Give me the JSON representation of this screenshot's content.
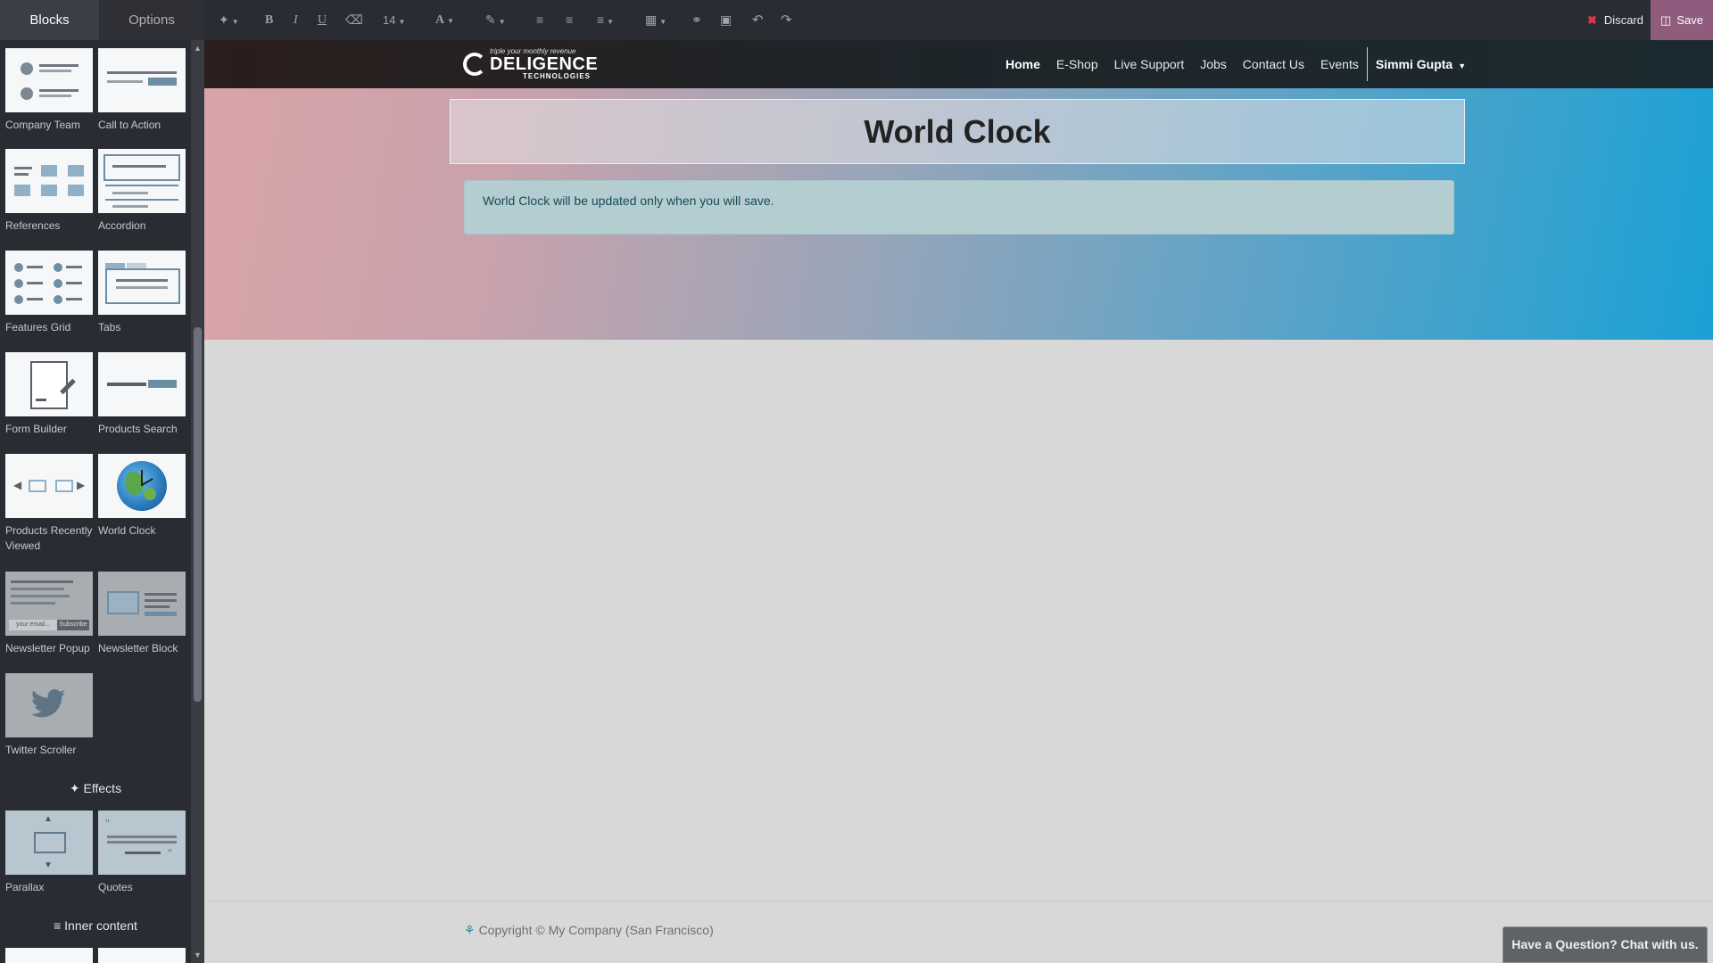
{
  "sidebar": {
    "tabs": [
      "Blocks",
      "Options"
    ],
    "blocks": [
      {
        "label": "Company Team"
      },
      {
        "label": "Call to Action"
      },
      {
        "label": "References"
      },
      {
        "label": "Accordion"
      },
      {
        "label": "Features Grid"
      },
      {
        "label": "Tabs"
      },
      {
        "label": "Form Builder"
      },
      {
        "label": "Products Search"
      },
      {
        "label": "Products Recently Viewed"
      },
      {
        "label": "World Clock"
      },
      {
        "label": "Newsletter Popup",
        "thumb_text": "your email..."
      },
      {
        "label": "Newsletter Block"
      },
      {
        "label": "Twitter Scroller"
      },
      {
        "label": "Parallax"
      },
      {
        "label": "Quotes"
      }
    ],
    "sections": {
      "effects": "Effects",
      "inner_content": "Inner content"
    },
    "subscribe_text": "Subscribe"
  },
  "toolbar": {
    "font_size": "14",
    "discard_label": "Discard",
    "save_label": "Save"
  },
  "site": {
    "logo": {
      "tagline": "triple your monthly revenue",
      "name": "DELIGENCE",
      "sub": "TECHNOLOGIES"
    },
    "menu": [
      "Home",
      "E-Shop",
      "Live Support",
      "Jobs",
      "Contact Us",
      "Events"
    ],
    "user": "Simmi Gupta",
    "title": "World Clock",
    "alert": "World Clock will be updated only when you will save.",
    "copyright": "Copyright © My Company (San Francisco)",
    "chat": "Have a Question? Chat with us."
  }
}
